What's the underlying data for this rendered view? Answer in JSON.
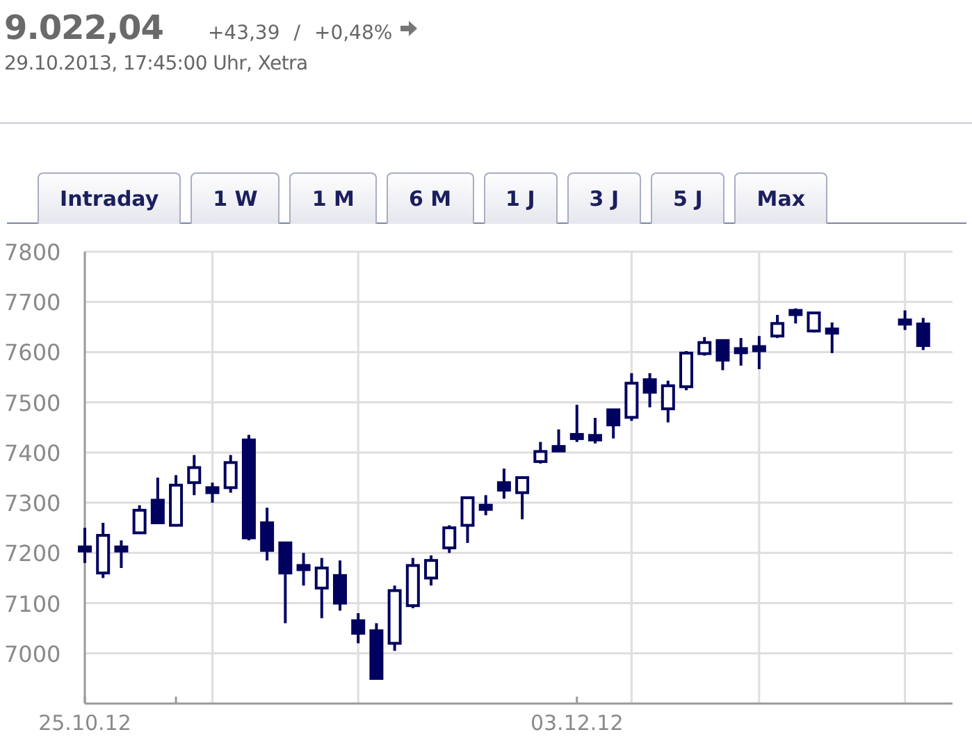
{
  "quote": {
    "value": "9.022,04",
    "change": "+43,39",
    "separator": "/",
    "change_percent": "+0,48%",
    "timestamp": "29.10.2013, 17:45:00 Uhr, Xetra"
  },
  "tabs": [
    {
      "label": "Intraday",
      "selected": false
    },
    {
      "label": "1 W",
      "selected": false
    },
    {
      "label": "1 M",
      "selected": false
    },
    {
      "label": "6 M",
      "selected": false
    },
    {
      "label": "1 J",
      "selected": false
    },
    {
      "label": "3 J",
      "selected": false
    },
    {
      "label": "5 J",
      "selected": false
    },
    {
      "label": "Max",
      "selected": false
    }
  ],
  "chart": {
    "chart_data": {
      "type": "candlestick",
      "categories": [
        "25.10.12",
        null,
        null,
        null,
        null,
        null,
        null,
        null,
        null,
        null,
        null,
        null,
        null,
        null,
        null,
        null,
        null,
        null,
        null,
        null,
        null,
        null,
        null,
        null,
        null,
        null,
        null,
        "03.12.12",
        null,
        null,
        null,
        null,
        null,
        null,
        null,
        null,
        null,
        null,
        null,
        null,
        null,
        null,
        null,
        null,
        null,
        null,
        null
      ],
      "ohlc": [
        [
          7212,
          7250,
          7180,
          7204
        ],
        [
          7160,
          7260,
          7150,
          7235
        ],
        [
          7212,
          7225,
          7170,
          7204
        ],
        [
          7240,
          7295,
          7240,
          7285
        ],
        [
          7305,
          7350,
          7260,
          7260
        ],
        [
          7255,
          7355,
          7255,
          7335
        ],
        [
          7340,
          7395,
          7315,
          7370
        ],
        [
          7330,
          7340,
          7300,
          7320
        ],
        [
          7330,
          7395,
          7320,
          7380
        ],
        [
          7425,
          7435,
          7225,
          7230
        ],
        [
          7260,
          7290,
          7185,
          7205
        ],
        [
          7220,
          7220,
          7060,
          7160
        ],
        [
          7175,
          7200,
          7135,
          7167
        ],
        [
          7130,
          7190,
          7070,
          7170
        ],
        [
          7155,
          7185,
          7085,
          7100
        ],
        [
          7065,
          7080,
          7020,
          7040
        ],
        [
          7045,
          7060,
          6950,
          6950
        ],
        [
          7020,
          7135,
          7005,
          7125
        ],
        [
          7095,
          7190,
          7090,
          7175
        ],
        [
          7150,
          7195,
          7135,
          7185
        ],
        [
          7210,
          7255,
          7200,
          7250
        ],
        [
          7255,
          7310,
          7220,
          7310
        ],
        [
          7295,
          7315,
          7275,
          7287
        ],
        [
          7340,
          7368,
          7308,
          7325
        ],
        [
          7320,
          7350,
          7267,
          7350
        ],
        [
          7382,
          7421,
          7378,
          7402
        ],
        [
          7412,
          7446,
          7402,
          7403
        ],
        [
          7436,
          7495,
          7421,
          7428
        ],
        [
          7434,
          7469,
          7418,
          7425
        ],
        [
          7485,
          7485,
          7428,
          7455
        ],
        [
          7470,
          7558,
          7463,
          7538
        ],
        [
          7545,
          7558,
          7490,
          7520
        ],
        [
          7487,
          7543,
          7460,
          7533
        ],
        [
          7531,
          7602,
          7524,
          7598
        ],
        [
          7597,
          7630,
          7593,
          7619
        ],
        [
          7623,
          7623,
          7564,
          7584
        ],
        [
          7607,
          7628,
          7573,
          7599
        ],
        [
          7611,
          7632,
          7566,
          7603
        ],
        [
          7632,
          7674,
          7628,
          7657
        ],
        [
          7683,
          7687,
          7657,
          7675
        ],
        [
          7642,
          7678,
          7639,
          7678
        ],
        [
          7646,
          7659,
          7598,
          7638
        ],
        null,
        null,
        null,
        [
          7664,
          7683,
          7644,
          7656
        ],
        [
          7656,
          7668,
          7604,
          7613
        ]
      ],
      "grid": true,
      "ylim": [
        6900,
        7800
      ],
      "yticks": [
        7000,
        7100,
        7200,
        7300,
        7400,
        7500,
        7600,
        7700,
        7800
      ]
    }
  }
}
